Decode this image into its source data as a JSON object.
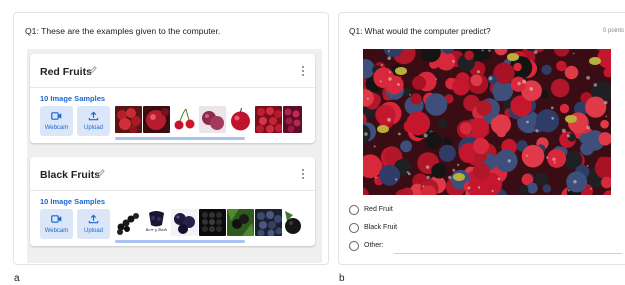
{
  "panel_a": {
    "question": "Q1: These are the examples given to the computer.",
    "classes": [
      {
        "name": "Red Fruits",
        "samples_label": "10 Image Samples",
        "webcam_label": "Webcam",
        "upload_label": "Upload"
      },
      {
        "name": "Black Fruits",
        "samples_label": "10 Image Samples",
        "webcam_label": "Webcam",
        "upload_label": "Upload",
        "thumb_caption": "Berr y Bush"
      }
    ]
  },
  "panel_b": {
    "question": "Q1: What would the computer predict?",
    "points": "0 points",
    "options": [
      "Red Fruit",
      "Black Fruit",
      "Other:"
    ]
  },
  "figure_labels": {
    "a": "a",
    "b": "b"
  },
  "colors": {
    "accent_blue": "#1967d2",
    "button_bg": "#dbe7f8",
    "canvas_bg": "#efefef"
  }
}
